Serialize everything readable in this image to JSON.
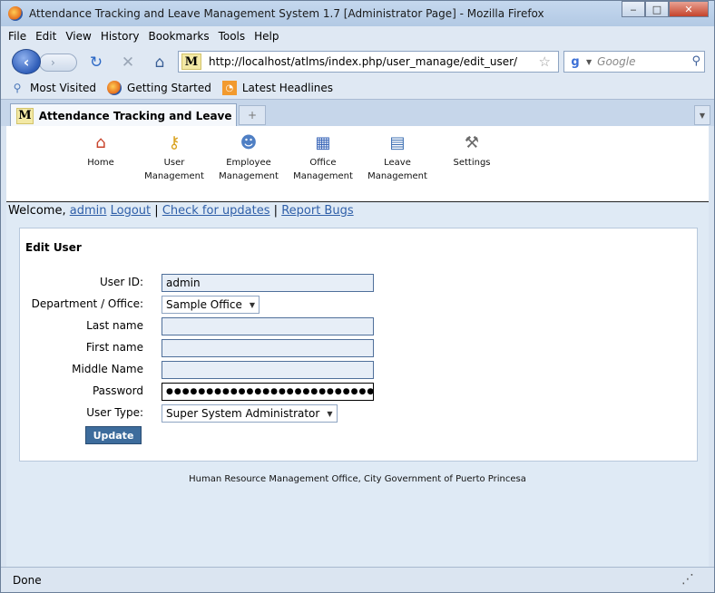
{
  "window": {
    "title": "Attendance Tracking and Leave Management System 1.7 [Administrator Page] - Mozilla Firefox",
    "minimize": "‒",
    "maximize": "□",
    "close": "✕"
  },
  "menubar": {
    "items": [
      "File",
      "Edit",
      "View",
      "History",
      "Bookmarks",
      "Tools",
      "Help"
    ]
  },
  "navbar": {
    "url": "http://localhost/atlms/index.php/user_manage/edit_user/admin",
    "site_badge": "M",
    "search_placeholder": "Google"
  },
  "bookmarks": {
    "items": [
      "Most Visited",
      "Getting Started",
      "Latest Headlines"
    ]
  },
  "tabs": {
    "active": "Attendance Tracking and Leave Man...",
    "badge": "M",
    "new_tab": "+"
  },
  "app_nav": {
    "items": [
      {
        "line1": "Home",
        "line2": ""
      },
      {
        "line1": "User",
        "line2": "Management"
      },
      {
        "line1": "Employee",
        "line2": "Management"
      },
      {
        "line1": "Office",
        "line2": "Management"
      },
      {
        "line1": "Leave",
        "line2": "Management"
      },
      {
        "line1": "Settings",
        "line2": ""
      }
    ]
  },
  "welcome": {
    "prefix": "Welcome,",
    "user": "admin",
    "logout": "Logout",
    "sep1": "|",
    "updates": "Check for updates",
    "sep2": "|",
    "bugs": "Report Bugs"
  },
  "form": {
    "title": "Edit User",
    "user_id_label": "User ID:",
    "user_id_value": "admin",
    "department_label": "Department / Office:",
    "department_value": "Sample Office",
    "last_name_label": "Last name",
    "last_name_value": "",
    "first_name_label": "First name",
    "first_name_value": "",
    "middle_name_label": "Middle Name",
    "middle_name_value": "",
    "password_label": "Password",
    "password_value": "●●●●●●●●●●●●●●●●●●●●●●●●●●●●●",
    "user_type_label": "User Type:",
    "user_type_value": "Super System Administrator",
    "update_label": "Update"
  },
  "footer": {
    "text": "Human Resource Management Office, City Government of Puerto Princesa"
  },
  "status": {
    "text": "Done"
  }
}
